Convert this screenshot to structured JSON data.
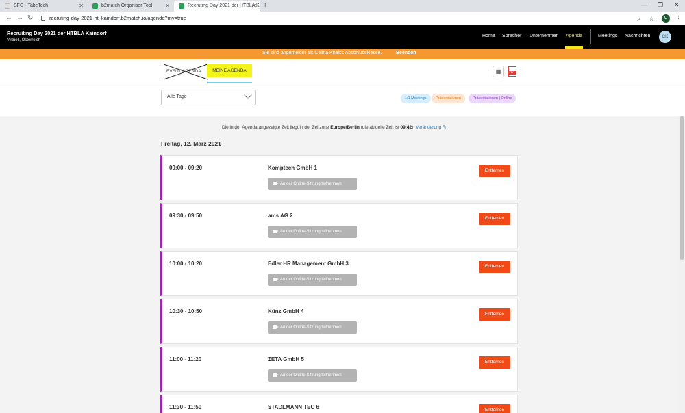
{
  "browser": {
    "tabs": [
      {
        "title": "SFG - TakeTech",
        "color": "#e8e8e8"
      },
      {
        "title": "b2match Organiser Tool",
        "color": "#2e9e5e"
      },
      {
        "title": "Recruting Day 2021 der HTBLA K",
        "color": "#2e9e5e"
      }
    ],
    "url": "recruting-day-2021-htl-kaindorf.b2match.io/agenda?my=true",
    "profile_initial": "C"
  },
  "header": {
    "event_title": "Recruiting Day 2021 der HTBLA Kaindorf",
    "event_subtitle": "Virtuell, Österreich",
    "nav": [
      "Home",
      "Sprecher",
      "Unternehmen",
      "Agenda",
      "Meetings",
      "Nachrichten"
    ],
    "active_nav": "Agenda",
    "avatar_initials": "CK"
  },
  "banner": {
    "text": "Sie sind angemeldet als Celina Kneiss Abschlussklasse.",
    "action": "Beenden"
  },
  "agenda_tabs": {
    "event": "EVENT AGENDA",
    "mine": "MEINE AGENDA",
    "pdf_label": "PDF"
  },
  "filter": {
    "day_select": "Alle Tage",
    "legend": [
      "1:1 Meetings",
      "Präsentationen",
      "Präsentationen | Online"
    ]
  },
  "timezone": {
    "prefix": "Die in der Agenda angezeigte Zeit liegt in der Zeitzone",
    "zone": "Europe/Berlin",
    "middle": "(die aktuelle Zeit ist",
    "time": "09:42",
    "suffix": ").",
    "change_link": "Veränderung"
  },
  "date_heading": "Freitag, 12. März 2021",
  "sessions": [
    {
      "time": "09:00 - 09:20",
      "company": "Komptech GmbH 1"
    },
    {
      "time": "09:30 - 09:50",
      "company": "ams AG 2"
    },
    {
      "time": "10:00 - 10:20",
      "company": "Edler HR Management GmbH 3"
    },
    {
      "time": "10:30 - 10:50",
      "company": "Künz GmbH 4"
    },
    {
      "time": "11:00 - 11:20",
      "company": "ZETA GmbH 5"
    },
    {
      "time": "11:30 - 11:50",
      "company": "STADLMANN TEC 6"
    }
  ],
  "session_actions": {
    "join": "An der Online-Sitzung teilnehmen",
    "remove": "Entfernen"
  },
  "colors": {
    "banner": "#f59732",
    "accent_yellow": "#f4e21c",
    "session_border": "#9c27b0",
    "remove_button": "#f04a18"
  }
}
